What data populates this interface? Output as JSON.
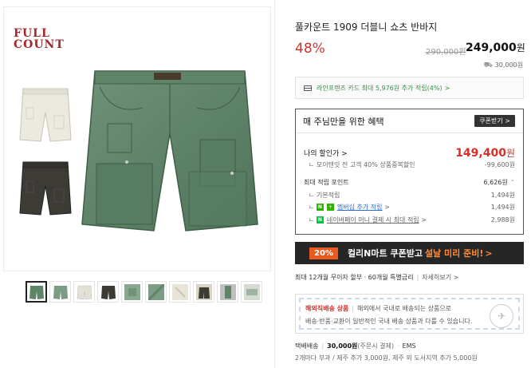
{
  "brand_logo": {
    "line1": "FULL",
    "line2": "COUNT",
    "color": "#a3282c"
  },
  "product": {
    "title": "풀카운트 1909 더블니 쇼츠 반바지",
    "discount_rate": "48%",
    "original_price": "290,000원",
    "sale_price": "249,000",
    "price_unit": "원",
    "delivery_fee": "30,000원"
  },
  "card_benefit": {
    "text": "라인프렌즈 카드 최대 5,976원 추가 적립(4%)",
    "arrow": ">"
  },
  "benefit_box": {
    "heading": "매 주님만을 위한 혜택",
    "coupon_button": "쿠폰받기",
    "my_discount_label": "나의 할인가",
    "my_discount_price": "149,400",
    "my_discount_unit": "원",
    "discount_detail_label": "모이텐잇 전 고객 40% 상품중복할인",
    "discount_detail_value": "-99,600원",
    "points_label": "최대 적립 포인트",
    "points_value": "6,626원",
    "basic_label": "기본적립",
    "basic_value": "1,494원",
    "membership_label": "멤버십 추가 적립",
    "membership_value": "1,494원",
    "naverpay_label": "네이버페이 머니 결제 시 최대 적립",
    "naverpay_value": "2,988원"
  },
  "promo_banner": {
    "percent": "20%",
    "text_white": "컬리N마트 쿠폰받고",
    "text_orange": "설날 미리 준비!",
    "arrow": ">"
  },
  "installment": {
    "text": "최대 12개월 무이자 할부 · 60개월 특별금리",
    "link": "자세히보기",
    "arrow": ">"
  },
  "overseas": {
    "label": "해외직배송 상품",
    "line1": "해외에서 국내로 배송되는 상품으로",
    "line2": "배송·반품·교환이 일반적인 국내 배송 상품과 다를 수 있습니다."
  },
  "shipping": {
    "label": "택배배송",
    "fee": "30,000원",
    "note": "(주문시 결제)",
    "method": "EMS",
    "extra": "2개마다 부과 / 제주 추가 3,000원, 제주 외 도서지역 추가 5,000원"
  },
  "colors": {
    "discount_red": "#d3312a",
    "green_link": "#3a8d46",
    "banner_bg": "#262626",
    "banner_orange": "#ff8c3a"
  },
  "thumbnails": [
    "green-shorts",
    "green-shorts-2",
    "white-shorts",
    "black-shorts",
    "green-detail",
    "green-detail-2",
    "white-detail",
    "black-shorts-2",
    "model-photo",
    "detail-photo"
  ]
}
